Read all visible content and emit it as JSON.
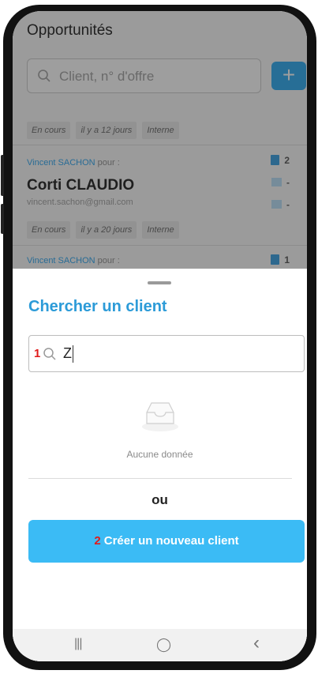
{
  "background_app": {
    "title": "Opportunités",
    "search_placeholder": "Client, n° d'offre",
    "add_label": "+",
    "row0_tags": [
      "En cours",
      "il y a 12 jours",
      "Interne"
    ],
    "card1": {
      "owner": "Vincent SACHON",
      "owner_suffix": "pour :",
      "client": "Corti CLAUDIO",
      "email": "vincent.sachon@gmail.com",
      "tags": [
        "En cours",
        "il y a 20 jours",
        "Interne"
      ],
      "stats": [
        "2",
        "-",
        "-"
      ]
    },
    "card2": {
      "owner": "Vincent SACHON",
      "owner_suffix": "pour :",
      "stats": [
        "1"
      ]
    }
  },
  "sheet": {
    "title": "Chercher un client",
    "input_marker": "1",
    "input_value": "Z",
    "empty_text": "Aucune donnée",
    "or_text": "ou",
    "create_marker": "2",
    "create_label": "Créer un nouveau client"
  },
  "navbar": {
    "recent": "|||",
    "home": "◯",
    "back": "‹"
  },
  "colors": {
    "accent": "#3bbbf5",
    "title_blue": "#2c9bd8",
    "marker_red": "#e01b1b"
  }
}
